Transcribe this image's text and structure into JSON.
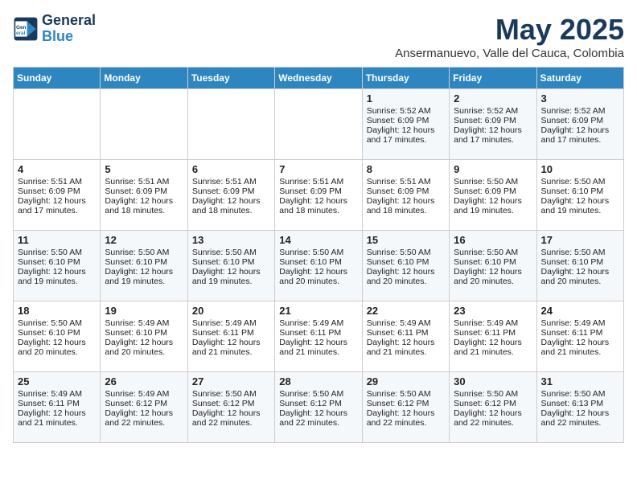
{
  "header": {
    "logo_line1": "General",
    "logo_line2": "Blue",
    "month": "May 2025",
    "location": "Ansermanuevo, Valle del Cauca, Colombia"
  },
  "weekdays": [
    "Sunday",
    "Monday",
    "Tuesday",
    "Wednesday",
    "Thursday",
    "Friday",
    "Saturday"
  ],
  "weeks": [
    [
      {
        "day": "",
        "info": ""
      },
      {
        "day": "",
        "info": ""
      },
      {
        "day": "",
        "info": ""
      },
      {
        "day": "",
        "info": ""
      },
      {
        "day": "1",
        "info": "Sunrise: 5:52 AM\nSunset: 6:09 PM\nDaylight: 12 hours\nand 17 minutes."
      },
      {
        "day": "2",
        "info": "Sunrise: 5:52 AM\nSunset: 6:09 PM\nDaylight: 12 hours\nand 17 minutes."
      },
      {
        "day": "3",
        "info": "Sunrise: 5:52 AM\nSunset: 6:09 PM\nDaylight: 12 hours\nand 17 minutes."
      }
    ],
    [
      {
        "day": "4",
        "info": "Sunrise: 5:51 AM\nSunset: 6:09 PM\nDaylight: 12 hours\nand 17 minutes."
      },
      {
        "day": "5",
        "info": "Sunrise: 5:51 AM\nSunset: 6:09 PM\nDaylight: 12 hours\nand 18 minutes."
      },
      {
        "day": "6",
        "info": "Sunrise: 5:51 AM\nSunset: 6:09 PM\nDaylight: 12 hours\nand 18 minutes."
      },
      {
        "day": "7",
        "info": "Sunrise: 5:51 AM\nSunset: 6:09 PM\nDaylight: 12 hours\nand 18 minutes."
      },
      {
        "day": "8",
        "info": "Sunrise: 5:51 AM\nSunset: 6:09 PM\nDaylight: 12 hours\nand 18 minutes."
      },
      {
        "day": "9",
        "info": "Sunrise: 5:50 AM\nSunset: 6:09 PM\nDaylight: 12 hours\nand 19 minutes."
      },
      {
        "day": "10",
        "info": "Sunrise: 5:50 AM\nSunset: 6:10 PM\nDaylight: 12 hours\nand 19 minutes."
      }
    ],
    [
      {
        "day": "11",
        "info": "Sunrise: 5:50 AM\nSunset: 6:10 PM\nDaylight: 12 hours\nand 19 minutes."
      },
      {
        "day": "12",
        "info": "Sunrise: 5:50 AM\nSunset: 6:10 PM\nDaylight: 12 hours\nand 19 minutes."
      },
      {
        "day": "13",
        "info": "Sunrise: 5:50 AM\nSunset: 6:10 PM\nDaylight: 12 hours\nand 19 minutes."
      },
      {
        "day": "14",
        "info": "Sunrise: 5:50 AM\nSunset: 6:10 PM\nDaylight: 12 hours\nand 20 minutes."
      },
      {
        "day": "15",
        "info": "Sunrise: 5:50 AM\nSunset: 6:10 PM\nDaylight: 12 hours\nand 20 minutes."
      },
      {
        "day": "16",
        "info": "Sunrise: 5:50 AM\nSunset: 6:10 PM\nDaylight: 12 hours\nand 20 minutes."
      },
      {
        "day": "17",
        "info": "Sunrise: 5:50 AM\nSunset: 6:10 PM\nDaylight: 12 hours\nand 20 minutes."
      }
    ],
    [
      {
        "day": "18",
        "info": "Sunrise: 5:50 AM\nSunset: 6:10 PM\nDaylight: 12 hours\nand 20 minutes."
      },
      {
        "day": "19",
        "info": "Sunrise: 5:49 AM\nSunset: 6:10 PM\nDaylight: 12 hours\nand 20 minutes."
      },
      {
        "day": "20",
        "info": "Sunrise: 5:49 AM\nSunset: 6:11 PM\nDaylight: 12 hours\nand 21 minutes."
      },
      {
        "day": "21",
        "info": "Sunrise: 5:49 AM\nSunset: 6:11 PM\nDaylight: 12 hours\nand 21 minutes."
      },
      {
        "day": "22",
        "info": "Sunrise: 5:49 AM\nSunset: 6:11 PM\nDaylight: 12 hours\nand 21 minutes."
      },
      {
        "day": "23",
        "info": "Sunrise: 5:49 AM\nSunset: 6:11 PM\nDaylight: 12 hours\nand 21 minutes."
      },
      {
        "day": "24",
        "info": "Sunrise: 5:49 AM\nSunset: 6:11 PM\nDaylight: 12 hours\nand 21 minutes."
      }
    ],
    [
      {
        "day": "25",
        "info": "Sunrise: 5:49 AM\nSunset: 6:11 PM\nDaylight: 12 hours\nand 21 minutes."
      },
      {
        "day": "26",
        "info": "Sunrise: 5:49 AM\nSunset: 6:12 PM\nDaylight: 12 hours\nand 22 minutes."
      },
      {
        "day": "27",
        "info": "Sunrise: 5:50 AM\nSunset: 6:12 PM\nDaylight: 12 hours\nand 22 minutes."
      },
      {
        "day": "28",
        "info": "Sunrise: 5:50 AM\nSunset: 6:12 PM\nDaylight: 12 hours\nand 22 minutes."
      },
      {
        "day": "29",
        "info": "Sunrise: 5:50 AM\nSunset: 6:12 PM\nDaylight: 12 hours\nand 22 minutes."
      },
      {
        "day": "30",
        "info": "Sunrise: 5:50 AM\nSunset: 6:12 PM\nDaylight: 12 hours\nand 22 minutes."
      },
      {
        "day": "31",
        "info": "Sunrise: 5:50 AM\nSunset: 6:13 PM\nDaylight: 12 hours\nand 22 minutes."
      }
    ]
  ]
}
